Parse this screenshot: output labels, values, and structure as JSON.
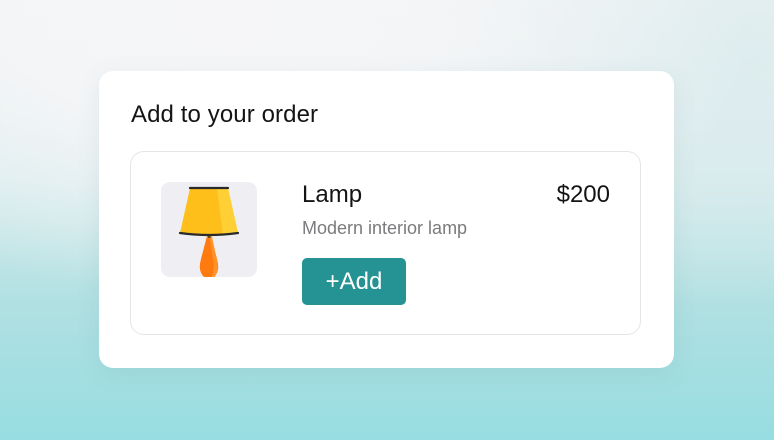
{
  "order": {
    "title": "Add to your order"
  },
  "product": {
    "name": "Lamp",
    "description": "Modern interior lamp",
    "price": "$200",
    "image_icon": "table-lamp-icon",
    "add_label": "+Add"
  },
  "colors": {
    "accent": "#259393",
    "lamp_shade": "#ffbf1a",
    "lamp_base": "#ff7a0f",
    "thumb_bg": "#efeff3"
  }
}
